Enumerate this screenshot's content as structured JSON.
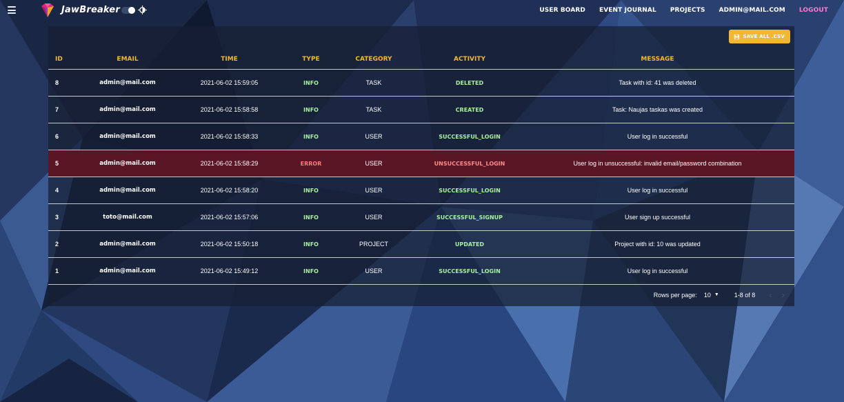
{
  "colors": {
    "accent": "#f4b731",
    "logout": "#ff7ad1",
    "info": "#a8f0a0",
    "error": "#ff7a7a",
    "error_row_bg": "#5a1624"
  },
  "navbar": {
    "brand": "JawBreaker",
    "links": [
      "USER BOARD",
      "EVENT JOURNAL",
      "PROJECTS",
      "ADMIN@MAIL.COM",
      "LOGOUT"
    ]
  },
  "toolbar": {
    "save_label": "SAVE ALL .CSV"
  },
  "table": {
    "headers": [
      "ID",
      "EMAIL",
      "TIME",
      "TYPE",
      "CATEGORY",
      "ACTIVITY",
      "MESSAGE"
    ],
    "rows": [
      {
        "id": "8",
        "email": "admin@mail.com",
        "time": "2021-06-02 15:59:05",
        "type": "INFO",
        "category": "TASK",
        "activity": "DELETED",
        "message": "Task with id: 41 was deleted"
      },
      {
        "id": "7",
        "email": "admin@mail.com",
        "time": "2021-06-02 15:58:58",
        "type": "INFO",
        "category": "TASK",
        "activity": "CREATED",
        "message": "Task: Naujas taskas was created"
      },
      {
        "id": "6",
        "email": "admin@mail.com",
        "time": "2021-06-02 15:58:33",
        "type": "INFO",
        "category": "USER",
        "activity": "SUCCESSFUL_LOGIN",
        "message": "User log in successful"
      },
      {
        "id": "5",
        "email": "admin@mail.com",
        "time": "2021-06-02 15:58:29",
        "type": "ERROR",
        "category": "USER",
        "activity": "UNSUCCESSFUL_LOGIN",
        "message": "User log in unsuccessful: invalid email/password combination"
      },
      {
        "id": "4",
        "email": "admin@mail.com",
        "time": "2021-06-02 15:58:20",
        "type": "INFO",
        "category": "USER",
        "activity": "SUCCESSFUL_LOGIN",
        "message": "User log in successful"
      },
      {
        "id": "3",
        "email": "toto@mail.com",
        "time": "2021-06-02 15:57:06",
        "type": "INFO",
        "category": "USER",
        "activity": "SUCCESSFUL_SIGNUP",
        "message": "User sign up successful"
      },
      {
        "id": "2",
        "email": "admin@mail.com",
        "time": "2021-06-02 15:50:18",
        "type": "INFO",
        "category": "PROJECT",
        "activity": "UPDATED",
        "message": "Project with id: 10 was updated"
      },
      {
        "id": "1",
        "email": "admin@mail.com",
        "time": "2021-06-02 15:49:12",
        "type": "INFO",
        "category": "USER",
        "activity": "SUCCESSFUL_LOGIN",
        "message": "User log in successful"
      }
    ]
  },
  "pagination": {
    "rows_per_page_label": "Rows per page:",
    "rows_per_page_value": "10",
    "range": "1-8 of 8"
  }
}
